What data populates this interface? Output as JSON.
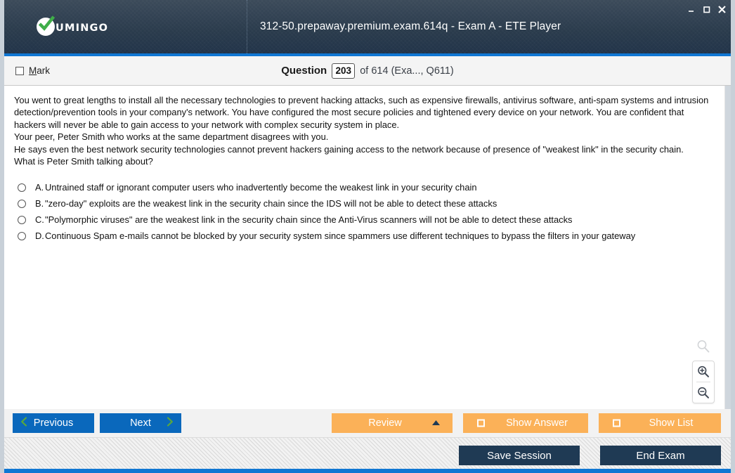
{
  "window": {
    "title": "312-50.prepaway.premium.exam.614q - Exam A - ETE Player",
    "minimize_label": "Minimize",
    "maximize_label": "Maximize",
    "close_label": "Close"
  },
  "branding": {
    "logo_text": "UMINGO",
    "accent_green": "#3fae49",
    "header_blue": "#1077d3"
  },
  "question_bar": {
    "mark_label_prefix": "M",
    "mark_label_rest": "ark",
    "question_label": "Question",
    "question_number": "203",
    "of_text": "of 614 (Exa..., Q611)"
  },
  "question": {
    "text": "You went to great lengths to install all the necessary technologies to prevent hacking attacks, such as expensive firewalls, antivirus software, anti-spam systems and intrusion detection/prevention tools in your company's network. You have configured the most secure policies and tightened every device on your network. You are confident that hackers will never be able to gain access to your network with complex security system in place.\nYour peer, Peter Smith who works at the same department disagrees with you.\nHe says even the best network security technologies cannot prevent hackers gaining access to the network because of presence of \"weakest link\" in the security chain.\nWhat is Peter Smith talking about?",
    "options": [
      {
        "letter": "A.",
        "text": "Untrained staff or ignorant computer users who inadvertently become the weakest link in your security chain"
      },
      {
        "letter": "B.",
        "text": "\"zero-day\" exploits are the weakest link in the security chain since the IDS will not be able to detect these attacks"
      },
      {
        "letter": "C.",
        "text": "\"Polymorphic viruses\" are the weakest link in the security chain since the Anti-Virus scanners will not be able to detect these attacks"
      },
      {
        "letter": "D.",
        "text": "Continuous Spam e-mails cannot be blocked by your security system since spammers use different techniques to bypass the filters in your gateway"
      }
    ],
    "selected": null
  },
  "zoom_tools": {
    "ghost_label": "search-magnifier",
    "zoom_in_label": "Zoom In",
    "zoom_out_label": "Zoom Out"
  },
  "actions": {
    "previous": "Previous",
    "next": "Next",
    "review": "Review",
    "show_answer": "Show Answer",
    "show_list": "Show List",
    "orange": "#fbb158",
    "blue": "#0a68bc",
    "chevron_green": "#5aa83c"
  },
  "status": {
    "save_session": "Save Session",
    "end_exam": "End Exam",
    "dark": "#1f3a54"
  }
}
